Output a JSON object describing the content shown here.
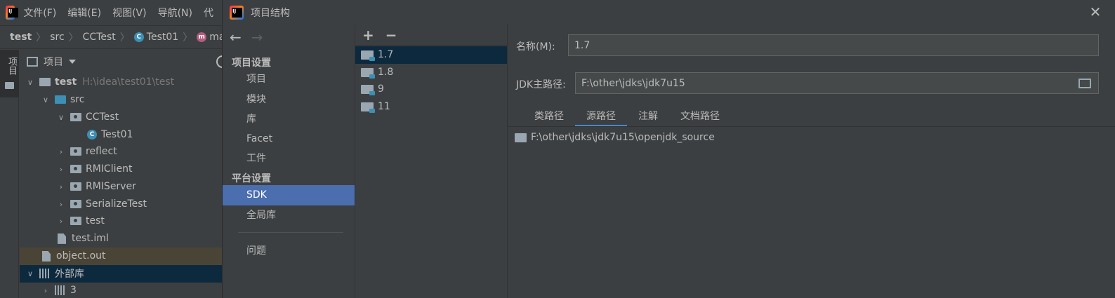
{
  "ide": {
    "menu": [
      "文件(F)",
      "编辑(E)",
      "视图(V)",
      "导航(N)",
      "代"
    ],
    "breadcrumbs": [
      "test",
      "src",
      "CCTest",
      "Test01",
      "main"
    ],
    "side_tab_label": "项目",
    "project_panel_title": "项目",
    "tree": [
      {
        "label": "test",
        "path": "H:\\idea\\test01\\test"
      },
      {
        "label": "src"
      },
      {
        "label": "CCTest"
      },
      {
        "label": "Test01"
      },
      {
        "label": "reflect"
      },
      {
        "label": "RMIClient"
      },
      {
        "label": "RMIServer"
      },
      {
        "label": "SerializeTest"
      },
      {
        "label": "test"
      },
      {
        "label": "test.iml"
      },
      {
        "label": "object.out"
      },
      {
        "label": "外部库"
      },
      {
        "label": "3"
      }
    ]
  },
  "dialog": {
    "title": "项目结构",
    "nav": {
      "project_settings_header": "项目设置",
      "project_settings_items": [
        "项目",
        "模块",
        "库",
        "Facet",
        "工件"
      ],
      "platform_settings_header": "平台设置",
      "platform_settings_items": [
        "SDK",
        "全局库"
      ],
      "problems": "问题"
    },
    "sdk_list": [
      "1.7",
      "1.8",
      "9",
      "11"
    ],
    "detail": {
      "name_label": "名称(M):",
      "name_value": "1.7",
      "jdk_home_label": "JDK主路径:",
      "jdk_home_value": "F:\\other\\jdks\\jdk7u15",
      "tabs": [
        "类路径",
        "源路径",
        "注解",
        "文档路径"
      ],
      "active_tab": "源路径",
      "source_paths": [
        "F:\\other\\jdks\\jdk7u15\\openjdk_source"
      ]
    }
  },
  "colors": {
    "background": "#3c3f41",
    "selection": "#4b6eaf",
    "tree_selection": "#0d293e",
    "tab_accent": "#4a88c7"
  }
}
